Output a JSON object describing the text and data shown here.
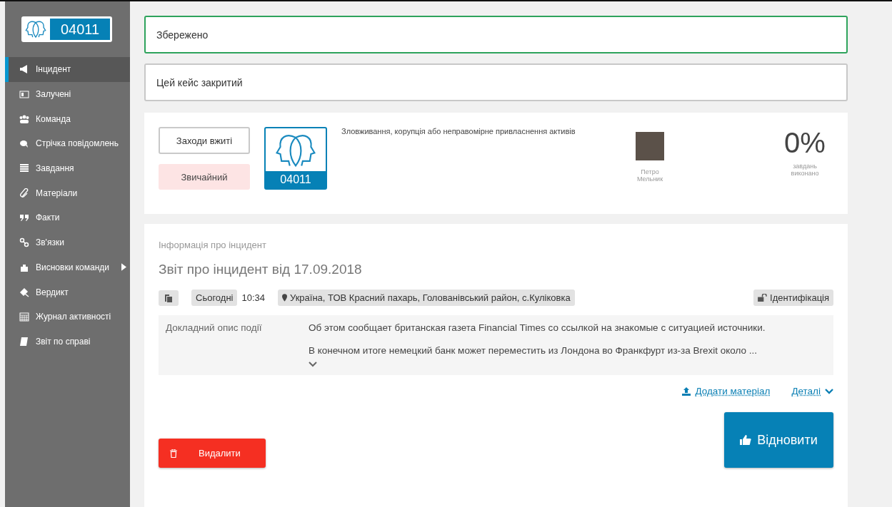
{
  "sidebar": {
    "logo_number": "04011",
    "items": [
      {
        "label": "Інцидент",
        "selected": true,
        "has_submenu": false
      },
      {
        "label": "Залучені",
        "selected": false,
        "has_submenu": false
      },
      {
        "label": "Команда",
        "selected": false,
        "has_submenu": false
      },
      {
        "label": "Стрічка повідомлень",
        "selected": false,
        "has_submenu": false
      },
      {
        "label": "Завдання",
        "selected": false,
        "has_submenu": false
      },
      {
        "label": "Матеріали",
        "selected": false,
        "has_submenu": false
      },
      {
        "label": "Факти",
        "selected": false,
        "has_submenu": false
      },
      {
        "label": "Зв'язки",
        "selected": false,
        "has_submenu": false
      },
      {
        "label": "Висновки команди",
        "selected": false,
        "has_submenu": true
      },
      {
        "label": "Вердикт",
        "selected": false,
        "has_submenu": false
      },
      {
        "label": "Журнал активності",
        "selected": false,
        "has_submenu": false
      },
      {
        "label": "Звіт по справі",
        "selected": false,
        "has_submenu": false
      }
    ]
  },
  "alerts": [
    {
      "text": "Збережено",
      "kind": "success"
    },
    {
      "text": "Цей кейс закритий",
      "kind": "info"
    }
  ],
  "summary": {
    "measures_button": "Заходи вжиті",
    "priority": "Звичайний",
    "case_number": "04011",
    "category": "Зловживання, корупція або неправомірне привласнення активів",
    "assignee": "Петро Мельник",
    "progress": "0%",
    "progress_label": "завдань виконано"
  },
  "incident": {
    "section_label": "Інформація про інцидент",
    "title": "Звіт про інцидент від 17.09.2018",
    "date": "Сьогодні",
    "time": "10:34",
    "location": "Україна, ТОВ Красний пахарь, Голованівський район, с.Куліковка",
    "identification": "Ідентифікація",
    "description_label": "Докладний опис події",
    "description": [
      "Об этом сообщает британская газета Financial Times со ссылкой на знакомые с ситуацией источники.",
      "В конечном итоге немецкий банк может переместить из Лондона во Франкфурт из-за Brexit около ..."
    ],
    "add_material": "Додати матеріал",
    "details": "Деталі",
    "delete_button": "Видалити",
    "restore_button": "Відновити"
  }
}
